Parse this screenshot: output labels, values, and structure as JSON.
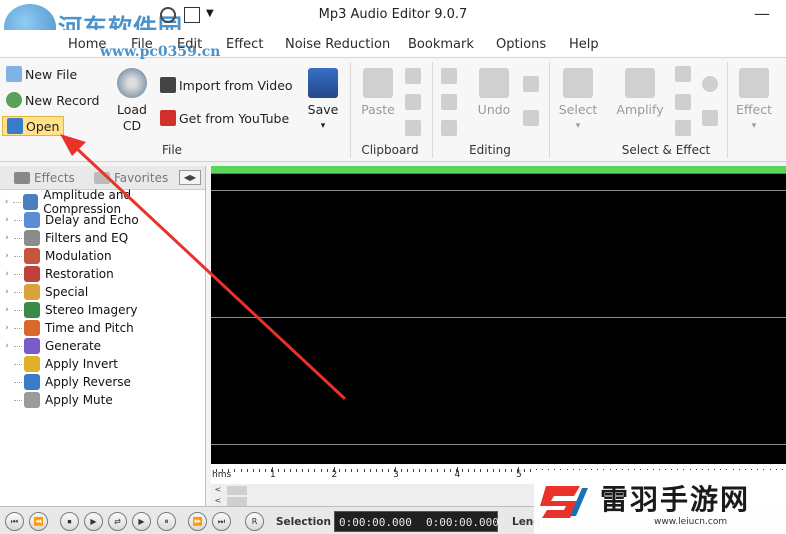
{
  "titlebar": {
    "title": "Mp3 Audio Editor 9.0.7",
    "watermark": "河东软件园",
    "watermark_url": "www.pc0359.cn",
    "minimize_glyph": "—",
    "dropdown_glyph": "▼"
  },
  "menu": [
    "Home",
    "File",
    "Edit",
    "Effect",
    "Noise Reduction",
    "Bookmark",
    "Options",
    "Help"
  ],
  "ribbon": {
    "file_group": {
      "label": "File",
      "new_file": "New File",
      "new_record": "New Record",
      "open": "Open",
      "load_cd_line1": "Load",
      "load_cd_line2": "CD",
      "import_video": "Import from Video",
      "youtube": "Get from YouTube",
      "save": "Save"
    },
    "clipboard_group": {
      "label": "Clipboard",
      "paste": "Paste"
    },
    "editing_group": {
      "label": "Editing",
      "undo": "Undo"
    },
    "select_effect_group": {
      "label": "Select & Effect",
      "select": "Select",
      "amplify": "Amplify",
      "effect": "Effect"
    },
    "chevron": "▾"
  },
  "panel": {
    "tab_effects": "Effects",
    "tab_favorites": "Favorites",
    "arrows": "◀▶",
    "items": [
      {
        "label": "Amplitude and Compression",
        "color": "#4b7fc4"
      },
      {
        "label": "Delay and Echo",
        "color": "#5a8bd6"
      },
      {
        "label": "Filters and EQ",
        "color": "#8c8c8c"
      },
      {
        "label": "Modulation",
        "color": "#c7553a"
      },
      {
        "label": "Restoration",
        "color": "#c0413a"
      },
      {
        "label": "Special",
        "color": "#d9a23a"
      },
      {
        "label": "Stereo Imagery",
        "color": "#3a8a4a"
      },
      {
        "label": "Time and Pitch",
        "color": "#d96a2b"
      },
      {
        "label": "Generate",
        "color": "#7a5bc9"
      },
      {
        "label": "Apply Invert",
        "color": "#e0b02a"
      },
      {
        "label": "Apply Reverse",
        "color": "#3b7cc9"
      },
      {
        "label": "Apply Mute",
        "color": "#9a9a9a"
      }
    ]
  },
  "ruler": {
    "unit": "hms",
    "ticks": [
      "1",
      "2",
      "3",
      "4",
      "5"
    ]
  },
  "transport": {
    "selection_label": "Selection",
    "selection_start": "0:00:00.000",
    "selection_end": "0:00:00.000",
    "length_label": "Leng",
    "buttons": [
      "⏮",
      "⏪",
      "⏹",
      "▶",
      "⇄",
      "▶",
      "⏸",
      "⏩",
      "⏭",
      "R"
    ]
  },
  "brand": {
    "name": "雷羽手游网",
    "url": "www.leiucn.com"
  },
  "colors": {
    "accent": "#2a7fc2",
    "arrow": "#e8322a",
    "progress": "#5ad45a"
  }
}
